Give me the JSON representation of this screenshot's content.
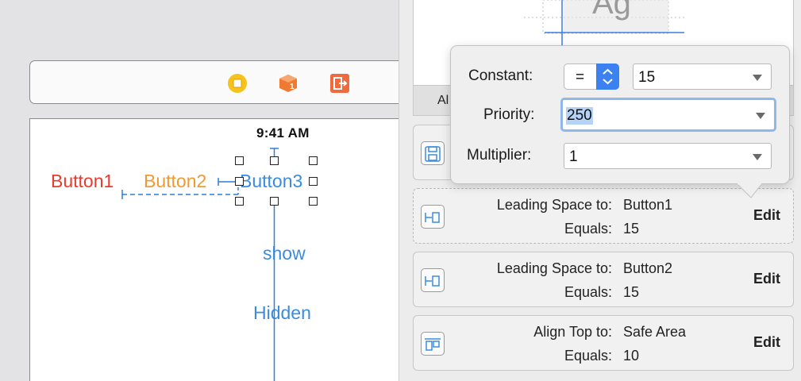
{
  "canvas": {
    "status_time": "9:41 AM",
    "buttons": [
      "Button1",
      "Button2",
      "Button3"
    ],
    "show_label": "show",
    "hidden_label": "Hidden",
    "dock_icons": [
      "view-controller-icon",
      "first-responder-icon",
      "exit-icon"
    ]
  },
  "inspector": {
    "preview_text": "Ag",
    "segment_label": "Al",
    "constraints": [
      {
        "title": "Leading Space to:",
        "target": "Button1",
        "equals_label": "Equals:",
        "equals_value": "15",
        "edit": "Edit"
      },
      {
        "title": "Leading Space to:",
        "target": "Button2",
        "equals_label": "Equals:",
        "equals_value": "15",
        "edit": "Edit"
      },
      {
        "title": "Align Top to:",
        "target": "Safe Area",
        "equals_label": "Equals:",
        "equals_value": "10",
        "edit": "Edit"
      }
    ]
  },
  "popover": {
    "constant_label": "Constant:",
    "relation": "=",
    "constant_value": "15",
    "priority_label": "Priority:",
    "priority_value": "250",
    "multiplier_label": "Multiplier:",
    "multiplier_value": "1"
  },
  "colors": {
    "button1": "#e53c2d",
    "button2": "#f09a34",
    "button3": "#3a8ce0",
    "constraint_line": "#2f7dd6",
    "stepper": "#3b82f0",
    "selection": "#b5d3f7"
  }
}
